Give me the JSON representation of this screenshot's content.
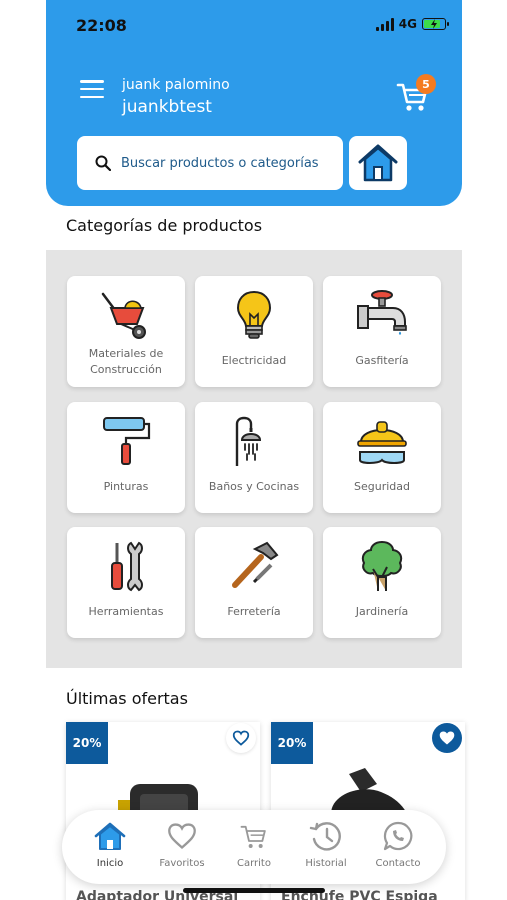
{
  "status_bar": {
    "time": "22:08",
    "network": "4G"
  },
  "header": {
    "user_name": "juank palomino",
    "user_handle": "juankbtest",
    "cart_count": "5"
  },
  "search": {
    "placeholder": "Buscar productos o categorías"
  },
  "categories": {
    "title": "Categorías de productos",
    "items": [
      {
        "label": "Materiales de Construcción",
        "icon": "wheelbarrow-icon"
      },
      {
        "label": "Electricidad",
        "icon": "lightbulb-icon"
      },
      {
        "label": "Gasfitería",
        "icon": "faucet-icon"
      },
      {
        "label": "Pinturas",
        "icon": "paint-roller-icon"
      },
      {
        "label": "Baños y Cocinas",
        "icon": "shower-icon"
      },
      {
        "label": "Seguridad",
        "icon": "safety-helmet-icon"
      },
      {
        "label": "Herramientas",
        "icon": "screwdriver-wrench-icon"
      },
      {
        "label": "Ferretería",
        "icon": "hammer-icon"
      },
      {
        "label": "Jardinería",
        "icon": "tree-icon"
      }
    ]
  },
  "offers": {
    "title": "Últimas ofertas",
    "items": [
      {
        "discount": "20%",
        "name": "Adaptador Universal",
        "favorited": false
      },
      {
        "discount": "20%",
        "name": "Enchufe PVC Espiga",
        "favorited": true
      }
    ]
  },
  "bottom_nav": {
    "items": [
      {
        "label": "Inicio",
        "icon": "home-icon",
        "active": true
      },
      {
        "label": "Favoritos",
        "icon": "heart-icon",
        "active": false
      },
      {
        "label": "Carrito",
        "icon": "cart-icon",
        "active": false
      },
      {
        "label": "Historial",
        "icon": "history-icon",
        "active": false
      },
      {
        "label": "Contacto",
        "icon": "whatsapp-icon",
        "active": false
      }
    ]
  },
  "colors": {
    "header": "#2d9bea",
    "accent_dark": "#0d5a9c",
    "badge": "#f47b20"
  }
}
